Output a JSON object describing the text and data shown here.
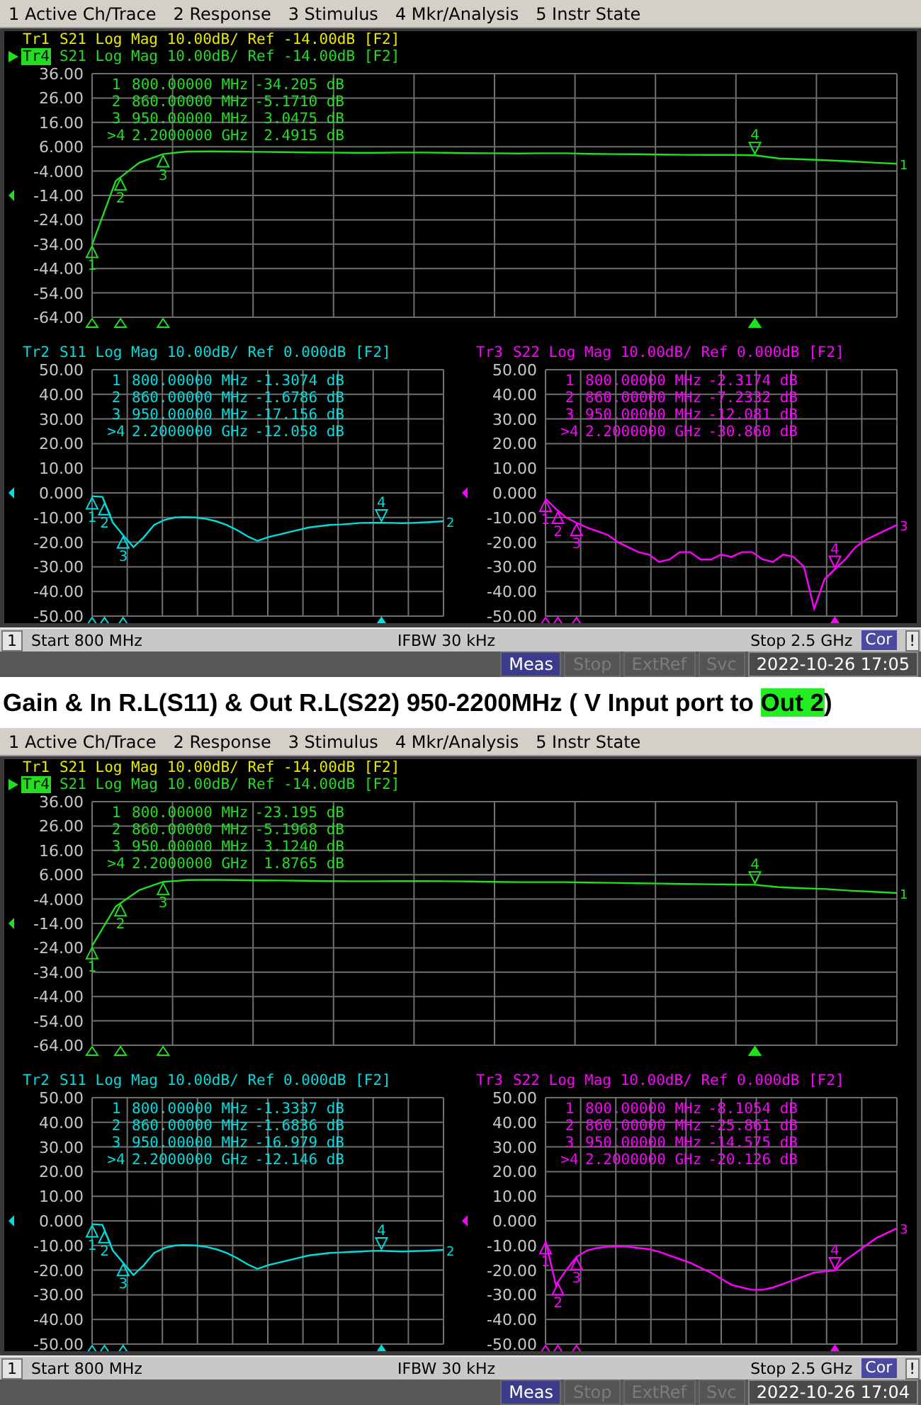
{
  "upper_screen": {
    "menu": [
      "1 Active Ch/Trace",
      "2 Response",
      "3 Stimulus",
      "4 Mkr/Analysis",
      "5 Instr State"
    ],
    "top_panel": {
      "traces": [
        {
          "label": "Tr1",
          "description": "S21 Log Mag 10.00dB/ Ref -14.00dB [F2]",
          "color": "#e8e800",
          "active": false
        },
        {
          "label": "Tr4",
          "description": "S21 Log Mag 10.00dB/ Ref -14.00dB [F2]",
          "color": "#22dd22",
          "active": true
        }
      ],
      "chart_data": {
        "type": "line",
        "grid": true,
        "ylim": [
          -64,
          36
        ],
        "yticks": [
          {
            "value": 36,
            "label": "36.00"
          },
          {
            "value": 26,
            "label": "26.00"
          },
          {
            "value": 16,
            "label": "16.00"
          },
          {
            "value": 6,
            "label": "6.000"
          },
          {
            "value": -4,
            "label": "-4.000"
          },
          {
            "value": -14,
            "label": "-14.00"
          },
          {
            "value": -24,
            "label": "-24.00"
          },
          {
            "value": -34,
            "label": "-34.00"
          },
          {
            "value": -44,
            "label": "-44.00"
          },
          {
            "value": -54,
            "label": "-54.00"
          },
          {
            "value": -64,
            "label": "-64.00"
          }
        ],
        "categories": [
          null,
          null,
          null,
          null,
          null,
          null,
          null,
          null,
          null,
          null,
          null,
          null,
          null,
          null,
          null,
          null,
          null,
          null,
          null,
          null,
          null,
          null,
          null,
          null,
          null,
          null,
          null,
          null,
          null,
          null,
          null,
          null,
          null,
          null,
          null
        ],
        "series": [
          {
            "color": "#22dd22",
            "values": [
              -34.2,
              -8,
              -0.5,
              3.0,
              4,
              4.1,
              4,
              3.9,
              3.8,
              3.7,
              3.6,
              3.5,
              3.5,
              3.6,
              3.6,
              3.5,
              3.4,
              3.3,
              3.2,
              3.3,
              3.3,
              3.1,
              3.0,
              2.9,
              2.8,
              2.7,
              2.6,
              2.6,
              2.5,
              1.2,
              0.8,
              0.5,
              0,
              -0.5,
              -1
            ]
          }
        ]
      },
      "marker_readouts": [
        {
          "number": "1",
          "stimulus": "800.00000 MHz",
          "value": "-34.205 dB"
        },
        {
          "number": "2",
          "stimulus": "860.00000 MHz",
          "value": "-5.1710 dB"
        },
        {
          "number": "3",
          "stimulus": "950.00000 MHz",
          "value": "3.0475 dB"
        },
        {
          "number": ">4",
          "stimulus": "2.2000000 GHz",
          "value": "2.4915 dB"
        }
      ],
      "markers": [
        {
          "number": "1",
          "active": false
        },
        {
          "number": "2",
          "active": false
        },
        {
          "number": "3",
          "active": false
        },
        {
          "number": "4",
          "active": true
        }
      ],
      "ref_label": "1"
    },
    "bottom_panels": [
      {
        "trace": {
          "label": "Tr2",
          "description": "S11 Log Mag 10.00dB/ Ref 0.000dB [F2]",
          "color": "#00dddd"
        },
        "chart_data": {
          "type": "line",
          "grid": true,
          "ylim": [
            -50,
            50
          ],
          "yticks": [
            {
              "value": 50,
              "label": "50.00"
            },
            {
              "value": 40,
              "label": "40.00"
            },
            {
              "value": 30,
              "label": "30.00"
            },
            {
              "value": 20,
              "label": "20.00"
            },
            {
              "value": 10,
              "label": "10.00"
            },
            {
              "value": 0,
              "label": "0.000"
            },
            {
              "value": -10,
              "label": "-10.00"
            },
            {
              "value": -20,
              "label": "-20.00"
            },
            {
              "value": -30,
              "label": "-30.00"
            },
            {
              "value": -40,
              "label": "-40.00"
            },
            {
              "value": -50,
              "label": "-50.00"
            }
          ],
          "categories": [
            null,
            null,
            null,
            null,
            null,
            null,
            null,
            null,
            null,
            null,
            null,
            null,
            null,
            null,
            null,
            null,
            null,
            null,
            null,
            null,
            null,
            null,
            null,
            null,
            null,
            null,
            null,
            null,
            null,
            null,
            null,
            null,
            null,
            null,
            null
          ],
          "series": [
            {
              "color": "#00dddd",
              "values": [
                -1.3,
                -1.6,
                -12,
                -17.2,
                -22,
                -18,
                -13,
                -11,
                -10,
                -9.8,
                -10,
                -10.5,
                -11.5,
                -13,
                -15,
                -17.5,
                -19.5,
                -18,
                -17,
                -16,
                -15,
                -14,
                -13.5,
                -13,
                -12.8,
                -12.5,
                -12.2,
                -12.1,
                -12.1,
                -12.2,
                -12.3,
                -12.2,
                -12,
                -11.8,
                -11.5
              ]
            }
          ]
        },
        "marker_readouts": [
          {
            "number": "1",
            "stimulus": "800.00000 MHz",
            "value": "-1.3074 dB"
          },
          {
            "number": "2",
            "stimulus": "860.00000 MHz",
            "value": "-1.6786 dB"
          },
          {
            "number": "3",
            "stimulus": "950.00000 MHz",
            "value": "-17.156 dB"
          },
          {
            "number": ">4",
            "stimulus": "2.2000000 GHz",
            "value": "-12.058 dB"
          }
        ],
        "markers": [
          {
            "number": "1",
            "active": false
          },
          {
            "number": "2",
            "active": false
          },
          {
            "number": "3",
            "active": false
          },
          {
            "number": "4",
            "active": true
          }
        ],
        "ref_label": "2"
      },
      {
        "trace": {
          "label": "Tr3",
          "description": "S22 Log Mag 10.00dB/ Ref 0.000dB [F2]",
          "color": "#ff00ff"
        },
        "chart_data": {
          "type": "line",
          "grid": true,
          "ylim": [
            -50,
            50
          ],
          "yticks": [
            {
              "value": 50,
              "label": "50.00"
            },
            {
              "value": 40,
              "label": "40.00"
            },
            {
              "value": 30,
              "label": "30.00"
            },
            {
              "value": 20,
              "label": "20.00"
            },
            {
              "value": 10,
              "label": "10.00"
            },
            {
              "value": 0,
              "label": "0.000"
            },
            {
              "value": -10,
              "label": "-10.00"
            },
            {
              "value": -20,
              "label": "-20.00"
            },
            {
              "value": -30,
              "label": "-30.00"
            },
            {
              "value": -40,
              "label": "-40.00"
            },
            {
              "value": -50,
              "label": "-50.00"
            }
          ],
          "categories": [
            null,
            null,
            null,
            null,
            null,
            null,
            null,
            null,
            null,
            null,
            null,
            null,
            null,
            null,
            null,
            null,
            null,
            null,
            null,
            null,
            null,
            null,
            null,
            null,
            null,
            null,
            null,
            null,
            null,
            null,
            null,
            null,
            null,
            null,
            null
          ],
          "series": [
            {
              "color": "#ff00ff",
              "values": [
                -2.3,
                -6.5,
                -10,
                -12.1,
                -14,
                -15.5,
                -17,
                -20,
                -22,
                -24,
                -25,
                -28,
                -27,
                -24,
                -24,
                -27,
                -27,
                -25,
                -26,
                -24,
                -24,
                -27,
                -28,
                -25,
                -26,
                -30,
                -47,
                -35,
                -30.9,
                -27,
                -22,
                -19,
                -17,
                -15,
                -13
              ]
            }
          ]
        },
        "marker_readouts": [
          {
            "number": "1",
            "stimulus": "800.00000 MHz",
            "value": "-2.3174 dB"
          },
          {
            "number": "2",
            "stimulus": "860.00000 MHz",
            "value": "-7.2332 dB"
          },
          {
            "number": "3",
            "stimulus": "950.00000 MHz",
            "value": "-12.081 dB"
          },
          {
            "number": ">4",
            "stimulus": "2.2000000 GHz",
            "value": "-30.860 dB"
          }
        ],
        "markers": [
          {
            "number": "1",
            "active": false
          },
          {
            "number": "2",
            "active": false
          },
          {
            "number": "3",
            "active": false
          },
          {
            "number": "4",
            "active": true
          }
        ],
        "ref_label": "3"
      }
    ],
    "channel_bar": {
      "channel": "1",
      "start": "Start 800 MHz",
      "ifbw": "IFBW 30 kHz",
      "stop": "Stop 2.5 GHz",
      "correction": "Cor",
      "alert": "!"
    },
    "system_bar": {
      "indicators": [
        {
          "label": "Meas",
          "on": true
        },
        {
          "label": "Stop",
          "on": false
        },
        {
          "label": "ExtRef",
          "on": false
        },
        {
          "label": "Svc",
          "on": false
        }
      ],
      "datetime": "2022-10-26 17:05"
    }
  },
  "caption": {
    "parts": [
      {
        "text": "Gain & In R.L(S11) & Out R.L(S22) 950-2200MHz ( V Input port to ",
        "highlighted": false
      },
      {
        "text": "Out 2",
        "highlighted": true
      },
      {
        "text": ")",
        "highlighted": false
      }
    ]
  },
  "lower_screen": {
    "menu": [
      "1 Active Ch/Trace",
      "2 Response",
      "3 Stimulus",
      "4 Mkr/Analysis",
      "5 Instr State"
    ],
    "top_panel": {
      "traces": [
        {
          "label": "Tr1",
          "description": "S21 Log Mag 10.00dB/ Ref -14.00dB [F2]",
          "color": "#e8e800",
          "active": false
        },
        {
          "label": "Tr4",
          "description": "S21 Log Mag 10.00dB/ Ref -14.00dB [F2]",
          "color": "#22dd22",
          "active": true
        }
      ],
      "chart_data": {
        "type": "line",
        "grid": true,
        "ylim": [
          -64,
          36
        ],
        "yticks": [
          {
            "value": 36,
            "label": "36.00"
          },
          {
            "value": 26,
            "label": "26.00"
          },
          {
            "value": 16,
            "label": "16.00"
          },
          {
            "value": 6,
            "label": "6.000"
          },
          {
            "value": -4,
            "label": "-4.000"
          },
          {
            "value": -14,
            "label": "-14.00"
          },
          {
            "value": -24,
            "label": "-24.00"
          },
          {
            "value": -34,
            "label": "-34.00"
          },
          {
            "value": -44,
            "label": "-44.00"
          },
          {
            "value": -54,
            "label": "-54.00"
          },
          {
            "value": -64,
            "label": "-64.00"
          }
        ],
        "categories": [
          null,
          null,
          null,
          null,
          null,
          null,
          null,
          null,
          null,
          null,
          null,
          null,
          null,
          null,
          null,
          null,
          null,
          null,
          null,
          null,
          null,
          null,
          null,
          null,
          null,
          null,
          null,
          null,
          null,
          null,
          null,
          null,
          null,
          null,
          null
        ],
        "series": [
          {
            "color": "#22dd22",
            "values": [
              -23.2,
              -7,
              -0.3,
              3.1,
              3.8,
              3.9,
              3.8,
              3.7,
              3.6,
              3.5,
              3.4,
              3.3,
              3.3,
              3.4,
              3.4,
              3.3,
              3.2,
              3.1,
              3.0,
              3.0,
              3.0,
              2.8,
              2.7,
              2.5,
              2.4,
              2.2,
              2.1,
              2.0,
              1.9,
              0.9,
              0.5,
              0.1,
              -0.5,
              -1,
              -1.5
            ]
          }
        ]
      },
      "marker_readouts": [
        {
          "number": "1",
          "stimulus": "800.00000 MHz",
          "value": "-23.195 dB"
        },
        {
          "number": "2",
          "stimulus": "860.00000 MHz",
          "value": "-5.1968 dB"
        },
        {
          "number": "3",
          "stimulus": "950.00000 MHz",
          "value": "3.1240 dB"
        },
        {
          "number": ">4",
          "stimulus": "2.2000000 GHz",
          "value": "1.8765 dB"
        }
      ],
      "markers": [
        {
          "number": "1",
          "active": false
        },
        {
          "number": "2",
          "active": false
        },
        {
          "number": "3",
          "active": false
        },
        {
          "number": "4",
          "active": true
        }
      ],
      "ref_label": "1"
    },
    "bottom_panels": [
      {
        "trace": {
          "label": "Tr2",
          "description": "S11 Log Mag 10.00dB/ Ref 0.000dB [F2]",
          "color": "#00dddd"
        },
        "chart_data": {
          "type": "line",
          "grid": true,
          "ylim": [
            -50,
            50
          ],
          "yticks": [
            {
              "value": 50,
              "label": "50.00"
            },
            {
              "value": 40,
              "label": "40.00"
            },
            {
              "value": 30,
              "label": "30.00"
            },
            {
              "value": 20,
              "label": "20.00"
            },
            {
              "value": 10,
              "label": "10.00"
            },
            {
              "value": 0,
              "label": "0.000"
            },
            {
              "value": -10,
              "label": "-10.00"
            },
            {
              "value": -20,
              "label": "-20.00"
            },
            {
              "value": -30,
              "label": "-30.00"
            },
            {
              "value": -40,
              "label": "-40.00"
            },
            {
              "value": -50,
              "label": "-50.00"
            }
          ],
          "categories": [
            null,
            null,
            null,
            null,
            null,
            null,
            null,
            null,
            null,
            null,
            null,
            null,
            null,
            null,
            null,
            null,
            null,
            null,
            null,
            null,
            null,
            null,
            null,
            null,
            null,
            null,
            null,
            null,
            null,
            null,
            null,
            null,
            null,
            null,
            null
          ],
          "series": [
            {
              "color": "#00dddd",
              "values": [
                -1.3,
                -1.6,
                -12,
                -17,
                -22,
                -18,
                -13,
                -11,
                -10,
                -9.8,
                -10,
                -10.5,
                -11.5,
                -13,
                -15,
                -17.5,
                -19.5,
                -18,
                -17,
                -16,
                -15,
                -14,
                -13.5,
                -13,
                -12.8,
                -12.6,
                -12.4,
                -12.2,
                -12.1,
                -12.3,
                -12.4,
                -12.3,
                -12.2,
                -12,
                -11.8
              ]
            }
          ]
        },
        "marker_readouts": [
          {
            "number": "1",
            "stimulus": "800.00000 MHz",
            "value": "-1.3337 dB"
          },
          {
            "number": "2",
            "stimulus": "860.00000 MHz",
            "value": "-1.6836 dB"
          },
          {
            "number": "3",
            "stimulus": "950.00000 MHz",
            "value": "-16.979 dB"
          },
          {
            "number": ">4",
            "stimulus": "2.2000000 GHz",
            "value": "-12.146 dB"
          }
        ],
        "markers": [
          {
            "number": "1",
            "active": false
          },
          {
            "number": "2",
            "active": false
          },
          {
            "number": "3",
            "active": false
          },
          {
            "number": "4",
            "active": true
          }
        ],
        "ref_label": "2"
      },
      {
        "trace": {
          "label": "Tr3",
          "description": "S22 Log Mag 10.00dB/ Ref 0.000dB [F2]",
          "color": "#ff00ff"
        },
        "chart_data": {
          "type": "line",
          "grid": true,
          "ylim": [
            -50,
            50
          ],
          "yticks": [
            {
              "value": 50,
              "label": "50.00"
            },
            {
              "value": 40,
              "label": "40.00"
            },
            {
              "value": 30,
              "label": "30.00"
            },
            {
              "value": 20,
              "label": "20.00"
            },
            {
              "value": 10,
              "label": "10.00"
            },
            {
              "value": 0,
              "label": "0.000"
            },
            {
              "value": -10,
              "label": "-10.00"
            },
            {
              "value": -20,
              "label": "-20.00"
            },
            {
              "value": -30,
              "label": "-30.00"
            },
            {
              "value": -40,
              "label": "-40.00"
            },
            {
              "value": -50,
              "label": "-50.00"
            }
          ],
          "categories": [
            null,
            null,
            null,
            null,
            null,
            null,
            null,
            null,
            null,
            null,
            null,
            null,
            null,
            null,
            null,
            null,
            null,
            null,
            null,
            null,
            null,
            null,
            null,
            null,
            null,
            null,
            null,
            null,
            null,
            null,
            null,
            null,
            null,
            null,
            null
          ],
          "series": [
            {
              "color": "#ff00ff",
              "values": [
                -8.1,
                -26,
                -20,
                -14.6,
                -12,
                -11,
                -10.5,
                -10.3,
                -10.5,
                -11,
                -11.5,
                -12.5,
                -14,
                -15.5,
                -17,
                -19,
                -21,
                -23.5,
                -26,
                -27,
                -28,
                -28,
                -27,
                -25.5,
                -24,
                -22.5,
                -21,
                -20.5,
                -20.1,
                -16,
                -13,
                -10,
                -7,
                -5,
                -3
              ]
            }
          ]
        },
        "marker_readouts": [
          {
            "number": "1",
            "stimulus": "800.00000 MHz",
            "value": "-8.1054 dB"
          },
          {
            "number": "2",
            "stimulus": "860.00000 MHz",
            "value": "-25.861 dB"
          },
          {
            "number": "3",
            "stimulus": "950.00000 MHz",
            "value": "-14.575 dB"
          },
          {
            "number": ">4",
            "stimulus": "2.2000000 GHz",
            "value": "-20.126 dB"
          }
        ],
        "markers": [
          {
            "number": "1",
            "active": false
          },
          {
            "number": "2",
            "active": false
          },
          {
            "number": "3",
            "active": false
          },
          {
            "number": "4",
            "active": true
          }
        ],
        "ref_label": "3"
      }
    ],
    "channel_bar": {
      "channel": "1",
      "start": "Start 800 MHz",
      "ifbw": "IFBW 30 kHz",
      "stop": "Stop 2.5 GHz",
      "correction": "Cor",
      "alert": "!"
    },
    "system_bar": {
      "indicators": [
        {
          "label": "Meas",
          "on": true
        },
        {
          "label": "Stop",
          "on": false
        },
        {
          "label": "ExtRef",
          "on": false
        },
        {
          "label": "Svc",
          "on": false
        }
      ],
      "datetime": "2022-10-26 17:04"
    }
  }
}
